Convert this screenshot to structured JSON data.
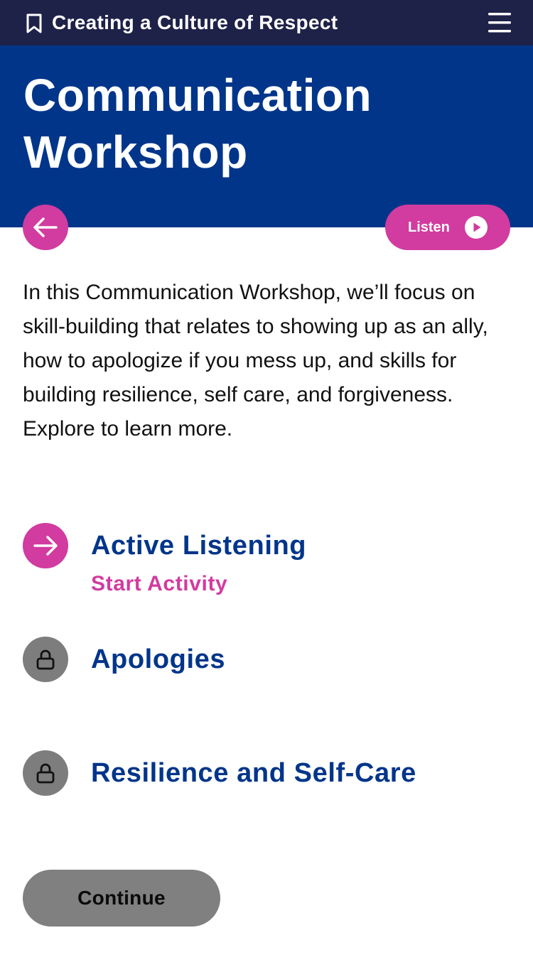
{
  "colors": {
    "topbar_bg": "#1e2148",
    "hero_bg": "#01358a",
    "accent_pink": "#d23b9f",
    "heading_blue": "#01358a",
    "locked_gray": "#7d7d7d",
    "button_gray": "#808080"
  },
  "topbar": {
    "title": "Creating a Culture of Respect",
    "left_icon": "bookmark-icon",
    "right_icon": "hamburger-menu-icon"
  },
  "hero": {
    "title": "Communication Workshop"
  },
  "back_button": {
    "icon": "arrow-left-icon"
  },
  "listen_button": {
    "label": "Listen",
    "icon": "play-icon"
  },
  "intro": {
    "text": "In this Communication Workshop, we’ll focus on skill-building that relates to showing up as an ally, how to apologize if you mess up, and skills for building resilience, self care, and forgiveness. Explore to learn more."
  },
  "activities": [
    {
      "title": "Active Listening",
      "action": "Start Activity",
      "status": "active",
      "icon": "arrow-right-icon"
    },
    {
      "title": "Apologies",
      "status": "locked",
      "icon": "lock-icon"
    },
    {
      "title": "Resilience and Self-Care",
      "status": "locked",
      "icon": "lock-icon"
    }
  ],
  "continue_button": {
    "label": "Continue"
  }
}
